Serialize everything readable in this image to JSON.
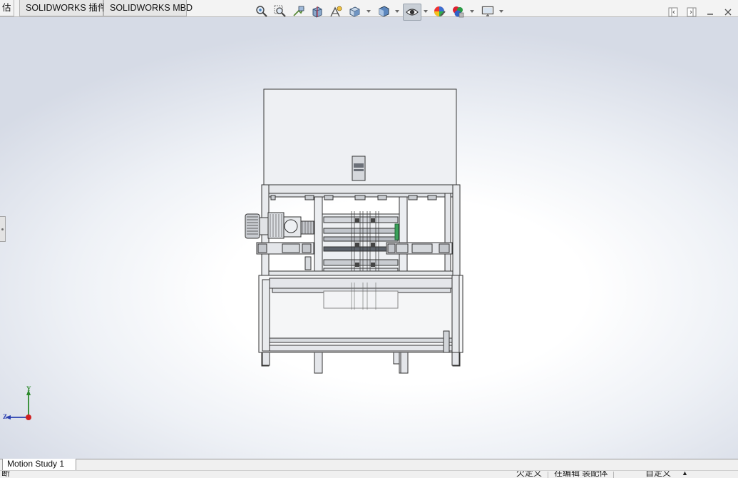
{
  "tabs": {
    "partial": "估",
    "items": [
      {
        "label": "SOLIDWORKS 插件"
      },
      {
        "label": "SOLIDWORKS MBD"
      }
    ]
  },
  "view_toolbar": {
    "icons": [
      "zoom-to-fit-icon",
      "zoom-to-area-icon",
      "previous-view-icon",
      "section-view-icon",
      "dynamic-annotation-icon",
      "view-orientation-icon",
      "display-style-icon",
      "hide-show-items-icon",
      "edit-appearance-icon",
      "apply-scene-icon",
      "view-settings-icon"
    ],
    "active": "hide-show-items-icon"
  },
  "window_controls": [
    "restore-left-icon",
    "restore-right-icon",
    "minimize-icon",
    "close-icon"
  ],
  "triad": {
    "y_label": "Y",
    "z_label": "Z"
  },
  "motion": {
    "tab_label": "Motion Study 1"
  },
  "status": {
    "left": "断",
    "under_defined": "欠定义",
    "editing": "在编辑 装配体",
    "custom": "自定义"
  },
  "colors": {
    "frame_fill": "#eef0f3",
    "frame_stroke": "#3a3a3a",
    "viewport_bg": "#e4e8f0"
  }
}
